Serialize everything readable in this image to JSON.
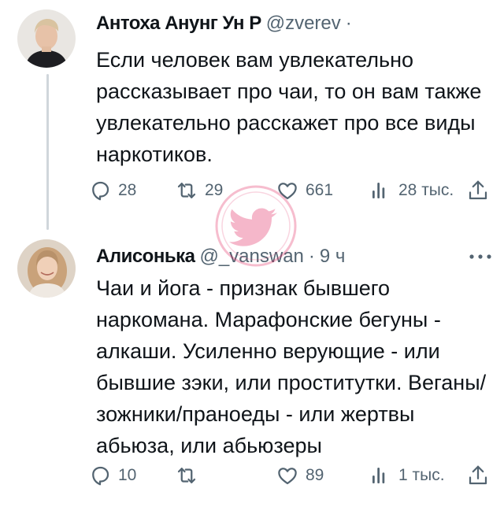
{
  "tweets": [
    {
      "author_name": "Антоха Анунг Ун Р",
      "handle": "@zverev",
      "separator": "·",
      "text": "Если человек вам увлекательно\nрассказывает про чаи, то он вам также\nувлекательно расскажет про все виды\nнаркотиков.",
      "replies": "28",
      "retweets": "29",
      "likes": "661",
      "views": "28 тыс."
    },
    {
      "author_name": "Алисонька",
      "handle": "@_vanswan",
      "separator": "·",
      "time": "9 ч",
      "text": "Чаи и йога - признак бывшего\nнаркомана. Марафонские бегуны -\nалкаши. Усиленно верующие - или\nбывшие зэки, или проститутки. Веганы/\nзожники/праноеды - или жертвы\nабьюза, или абьюзеры",
      "replies": "10",
      "retweets": "",
      "likes": "89",
      "views": "1 тыс."
    }
  ],
  "icons": {
    "reply": "reply-icon",
    "retweet": "retweet-icon",
    "like": "heart-icon",
    "views": "views-icon",
    "share": "share-icon",
    "more": "more-icon",
    "watermark": "twitter-bird-icon"
  },
  "colors": {
    "text": "#0f1419",
    "secondary": "#536471",
    "thread_line": "#d0d6db",
    "watermark": "#e0245e"
  }
}
